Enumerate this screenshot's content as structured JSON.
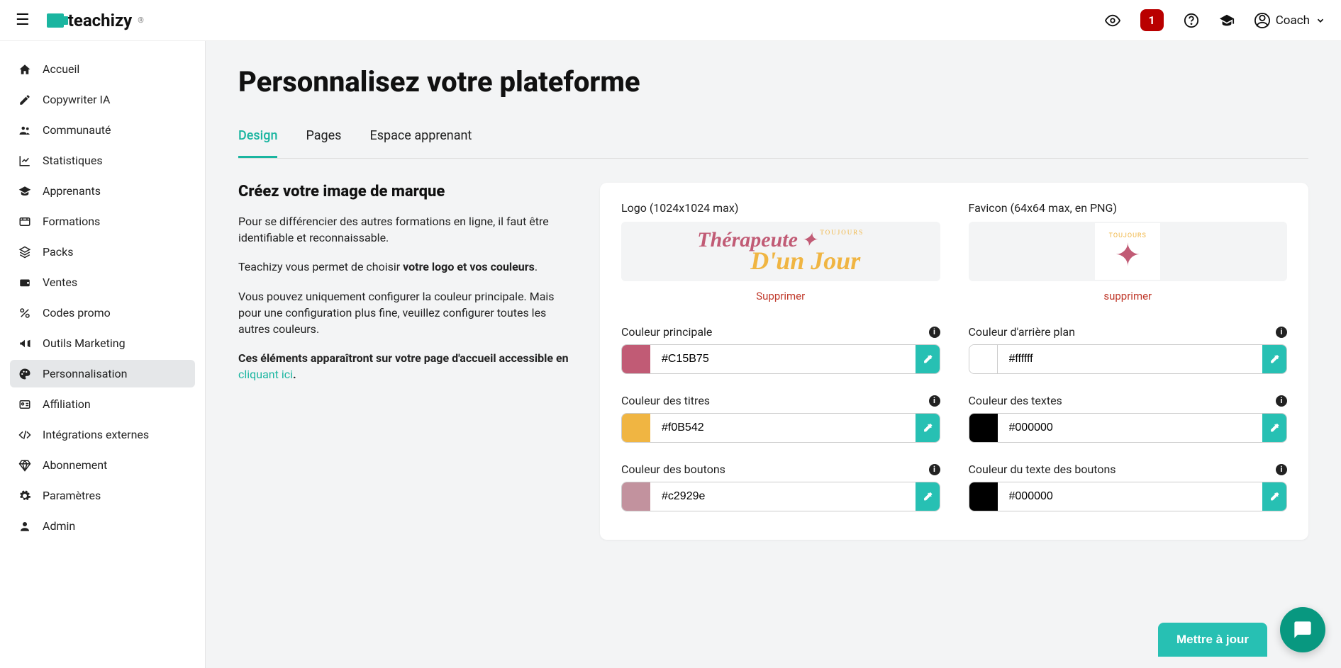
{
  "header": {
    "brand": "teachizy",
    "notif_count": "1",
    "user_label": "Coach"
  },
  "sidebar": {
    "items": [
      {
        "label": "Accueil",
        "icon": "home"
      },
      {
        "label": "Copywriter IA",
        "icon": "pen"
      },
      {
        "label": "Communauté",
        "icon": "users"
      },
      {
        "label": "Statistiques",
        "icon": "chart"
      },
      {
        "label": "Apprenants",
        "icon": "grad"
      },
      {
        "label": "Formations",
        "icon": "film"
      },
      {
        "label": "Packs",
        "icon": "stack"
      },
      {
        "label": "Ventes",
        "icon": "wallet"
      },
      {
        "label": "Codes promo",
        "icon": "percent"
      },
      {
        "label": "Outils Marketing",
        "icon": "mega"
      },
      {
        "label": "Personnalisation",
        "icon": "palette",
        "active": true
      },
      {
        "label": "Affiliation",
        "icon": "card"
      },
      {
        "label": "Intégrations externes",
        "icon": "code"
      },
      {
        "label": "Abonnement",
        "icon": "gem"
      },
      {
        "label": "Paramètres",
        "icon": "gear"
      },
      {
        "label": "Admin",
        "icon": "user"
      }
    ]
  },
  "page": {
    "title": "Personnalisez votre plateforme",
    "tabs": [
      "Design",
      "Pages",
      "Espace apprenant"
    ],
    "active_tab": 0
  },
  "left": {
    "title": "Créez votre image de marque",
    "p1": "Pour se différencier des autres formations en ligne, il faut être identifiable et reconnaissable.",
    "p2_a": "Teachizy vous permet de choisir ",
    "p2_b": "votre logo et vos couleurs",
    "p2_c": ".",
    "p3": "Vous pouvez uniquement configurer la couleur principale. Mais pour une configuration plus fine, veuillez configurer toutes les autres couleurs.",
    "p4_a": "Ces éléments apparaîtront sur votre page d'accueil accessible en ",
    "p4_link": "cliquant ici",
    "p4_b": "."
  },
  "uploads": {
    "logo_label": "Logo (1024x1024 max)",
    "logo_delete": "Supprimer",
    "logo_text1": "Thérapeute",
    "logo_text2": "D'un Jour",
    "logo_toujours": "TOUJOURS",
    "favicon_label": "Favicon (64x64 max, en PNG)",
    "favicon_delete": "supprimer",
    "favicon_toujours": "TOUJOURS"
  },
  "colors": {
    "primary": {
      "label": "Couleur principale",
      "value": "#C15B75",
      "swatch": "#C15B75"
    },
    "bg": {
      "label": "Couleur d'arrière plan",
      "value": "#ffffff",
      "swatch": "#ffffff"
    },
    "titles": {
      "label": "Couleur des titres",
      "value": "#f0B542",
      "swatch": "#f0B542"
    },
    "text": {
      "label": "Couleur des textes",
      "value": "#000000",
      "swatch": "#000000"
    },
    "buttons": {
      "label": "Couleur des boutons",
      "value": "#c2929e",
      "swatch": "#c2929e"
    },
    "btntext": {
      "label": "Couleur du texte des boutons",
      "value": "#000000",
      "swatch": "#000000"
    }
  },
  "footer": {
    "update": "Mettre à jour"
  }
}
